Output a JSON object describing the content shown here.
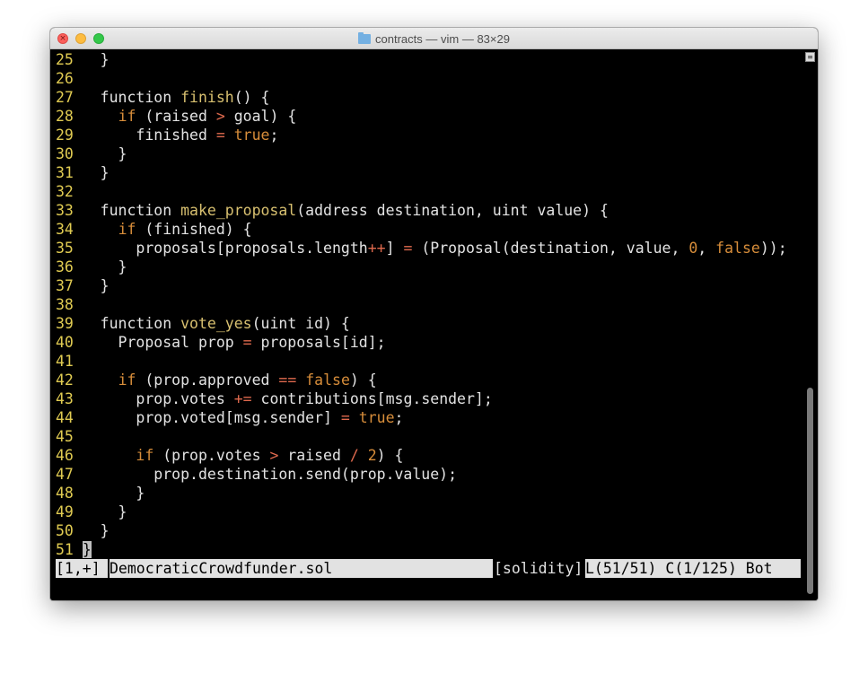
{
  "window": {
    "title": "contracts — vim — 83×29",
    "title_icon": "folder-icon"
  },
  "editor": {
    "lines": [
      {
        "n": "25",
        "text": "  }"
      },
      {
        "n": "26",
        "text": ""
      },
      {
        "n": "27",
        "text": "  function finish() {"
      },
      {
        "n": "28",
        "text": "    if (raised > goal) {"
      },
      {
        "n": "29",
        "text": "      finished = true;"
      },
      {
        "n": "30",
        "text": "    }"
      },
      {
        "n": "31",
        "text": "  }"
      },
      {
        "n": "32",
        "text": ""
      },
      {
        "n": "33",
        "text": "  function make_proposal(address destination, uint value) {"
      },
      {
        "n": "34",
        "text": "    if (finished) {"
      },
      {
        "n": "35",
        "text": "      proposals[proposals.length++] = (Proposal(destination, value, 0, false));"
      },
      {
        "n": "36",
        "text": "    }"
      },
      {
        "n": "37",
        "text": "  }"
      },
      {
        "n": "38",
        "text": ""
      },
      {
        "n": "39",
        "text": "  function vote_yes(uint id) {"
      },
      {
        "n": "40",
        "text": "    Proposal prop = proposals[id];"
      },
      {
        "n": "41",
        "text": ""
      },
      {
        "n": "42",
        "text": "    if (prop.approved == false) {"
      },
      {
        "n": "43",
        "text": "      prop.votes += contributions[msg.sender];"
      },
      {
        "n": "44",
        "text": "      prop.voted[msg.sender] = true;"
      },
      {
        "n": "45",
        "text": ""
      },
      {
        "n": "46",
        "text": "      if (prop.votes > raised / 2) {"
      },
      {
        "n": "47",
        "text": "        prop.destination.send(prop.value);"
      },
      {
        "n": "48",
        "text": "      }"
      },
      {
        "n": "49",
        "text": "    }"
      },
      {
        "n": "50",
        "text": "  }"
      },
      {
        "n": "51",
        "text": "}"
      }
    ]
  },
  "statusline": {
    "position": "[1,+]",
    "filename": "DemocraticCrowdfunder.sol",
    "filetype": "[solidity]",
    "location": "L(51/51) C(1/125) Bot"
  },
  "colors": {
    "background": "#000000",
    "text": "#e3e3e3",
    "line_number": "#e0cb52",
    "keyword": "#d78d3a",
    "function_name": "#d8c070",
    "operator": "#e06a4e",
    "statusline_bg": "#e2e2e2"
  }
}
